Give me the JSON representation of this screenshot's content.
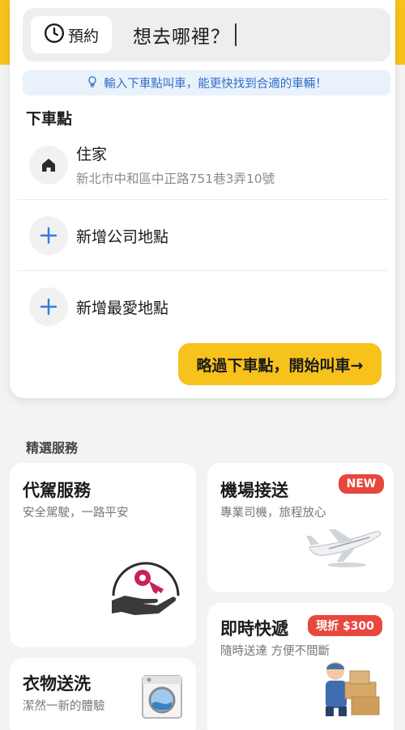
{
  "search": {
    "reserve_label": "預約",
    "prompt": "想去哪裡？",
    "hint": "輸入下車點叫車，能更快找到合適的車輛！"
  },
  "dropoff": {
    "section_title": "下車點",
    "home": {
      "name": "住家",
      "address": "新北市中和區中正路751巷3弄10號"
    },
    "add_company": "新增公司地點",
    "add_favorite": "新增最愛地點",
    "skip_button": "略過下車點，開始叫車→"
  },
  "services": {
    "section_title": "精選服務",
    "designated_driver": {
      "title": "代駕服務",
      "subtitle": "安全駕駛，一路平安"
    },
    "airport": {
      "title": "機場接送",
      "subtitle": "專業司機，旅程放心",
      "badge": "NEW"
    },
    "express": {
      "title": "即時快遞",
      "subtitle": "隨時送達 方便不間斷",
      "badge": "現折 $300"
    },
    "laundry": {
      "title": "衣物送洗",
      "subtitle": "潔然一新的體驗"
    }
  },
  "colors": {
    "brand_yellow": "#f7c21c",
    "hint_blue": "#2f6fc9",
    "badge_red": "#e8473d"
  }
}
